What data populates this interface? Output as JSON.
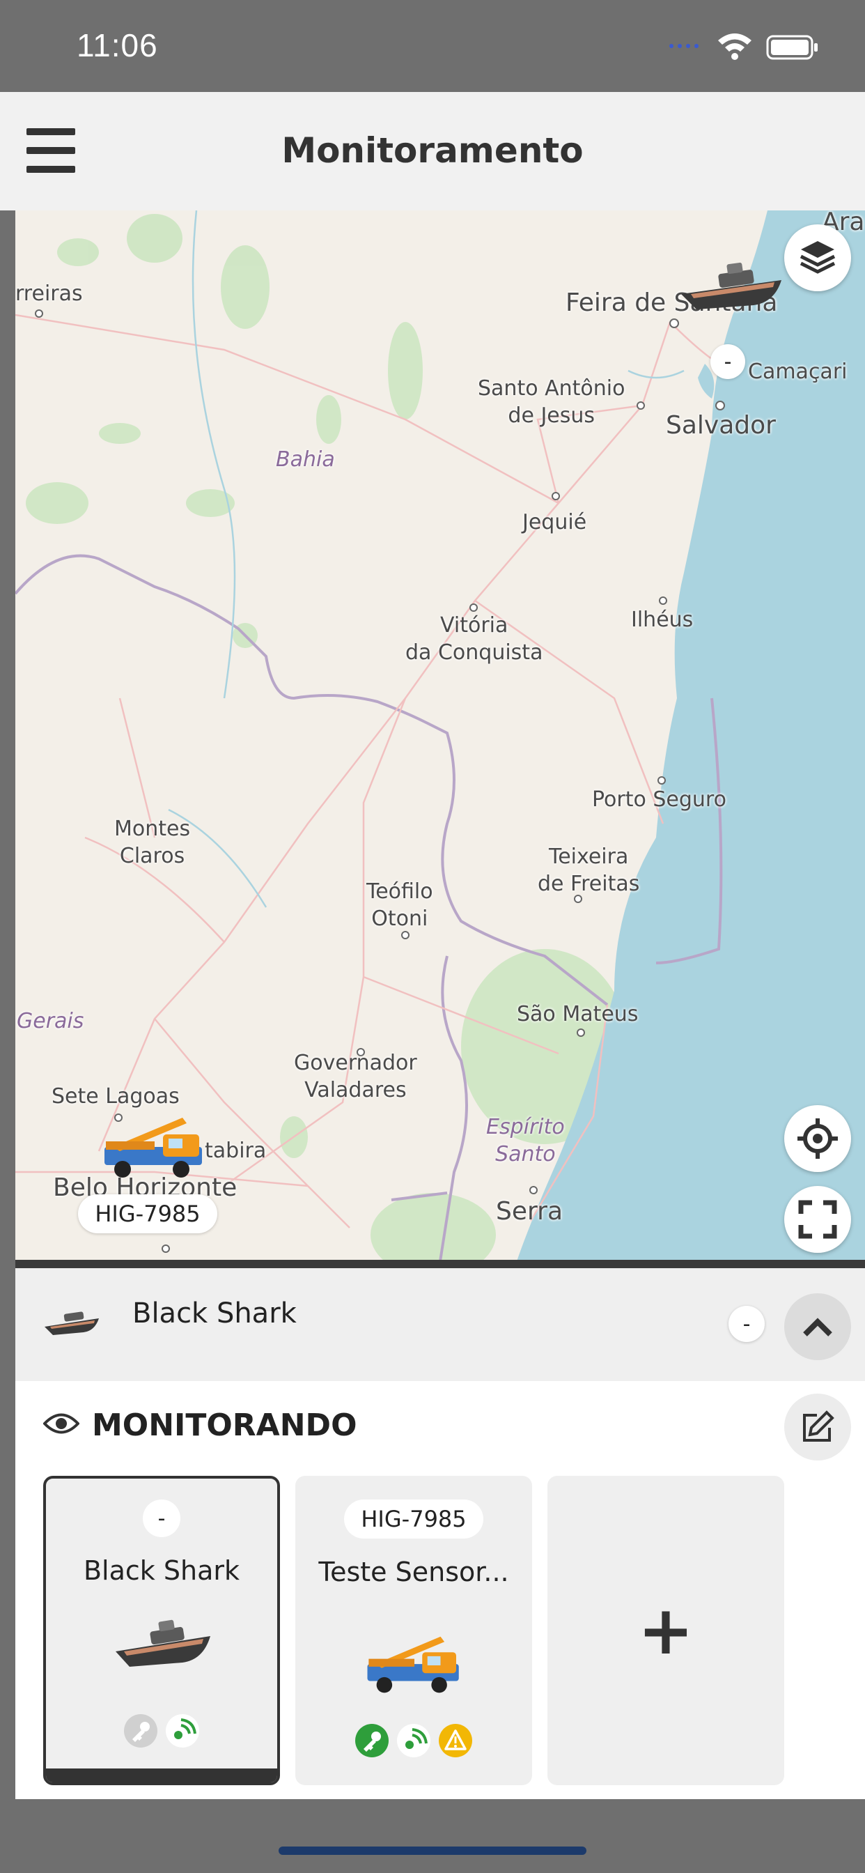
{
  "status_bar": {
    "time": "11:06",
    "battery_color": "#ffffff"
  },
  "header": {
    "title": "Monitoramento",
    "menu_icon": "hamburger-menu-icon"
  },
  "map": {
    "land_color": "#f3efe8",
    "water_color": "#aad3df",
    "vegetation_color": "#cde6c2",
    "labels": {
      "barreiras": "rreiras",
      "feira": "Feira de Santana",
      "ara": "Ara",
      "camacari": "Camaçari",
      "santo_antonio": "Santo Antônio\nde Jesus",
      "salvador": "Salvador",
      "bahia": "Bahia",
      "jequie": "Jequié",
      "vitoria": "Vitória\nda Conquista",
      "ilheus": "Ilhéus",
      "porto_seguro": "Porto Seguro",
      "montes_claros": "Montes\nClaros",
      "teixeira": "Teixeira\nde Freitas",
      "teofilo": "Teófilo\nOtoni",
      "sao_mateus": "São Mateus",
      "gerais": "Gerais",
      "governador": "Governador\nValadares",
      "sete_lagoas": "Sete Lagoas",
      "espirito_santo": "Espírito\nSanto",
      "itabira": "tabira",
      "belo_horizonte": "Belo Horizonte",
      "serra": "Serra"
    },
    "markers": {
      "boat_badge": "-",
      "truck_badge": "HIG-7985"
    },
    "controls": {
      "layers_icon": "layers-icon",
      "locate_icon": "crosshair-icon",
      "fullscreen_icon": "fullscreen-icon"
    }
  },
  "selected_vehicle": {
    "name": "Black Shark",
    "badge": "-",
    "collapse_icon": "chevron-up-icon"
  },
  "monitoring": {
    "title": "MONITORANDO",
    "cards": [
      {
        "badge": "-",
        "name": "Black Shark",
        "selected": true,
        "status_icons": [
          "key-icon",
          "signal-icon"
        ]
      },
      {
        "badge": "HIG-7985",
        "name": "Teste Sensor...",
        "selected": false,
        "status_icons": [
          "key-icon",
          "signal-icon",
          "warning-icon"
        ]
      }
    ],
    "add_label": "+"
  },
  "colors": {
    "green": "#2e9e3b",
    "warning": "#f2b705",
    "dark": "#333333"
  }
}
